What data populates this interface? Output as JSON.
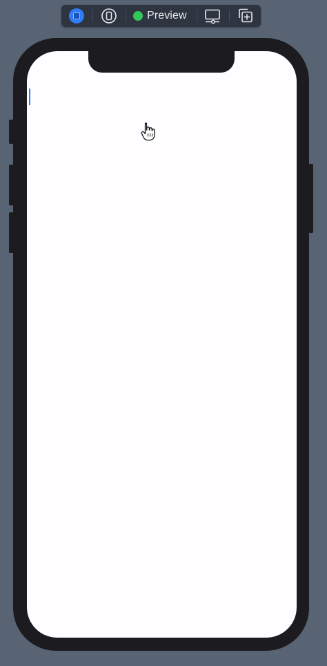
{
  "toolbar": {
    "live_preview_icon": "live-preview-icon",
    "device_icon": "iphone-device-icon",
    "preview_label": "Preview",
    "preview_status_color": "#32c759",
    "device_settings_icon": "device-settings-icon",
    "duplicate_preview_icon": "duplicate-preview-icon"
  },
  "canvas": {
    "background": "#586473",
    "phone_color": "#1c1b1f",
    "screen_color": "#fefdff",
    "cursor_color": "#2f7cf6"
  }
}
